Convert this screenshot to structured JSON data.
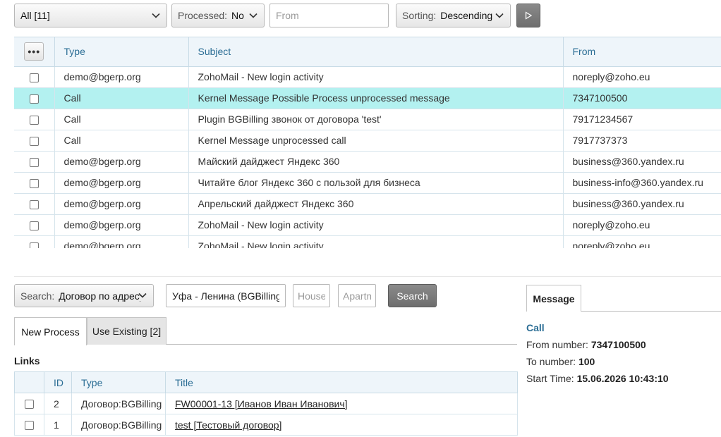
{
  "filters": {
    "type_select": {
      "value": "All [11]"
    },
    "processed_select": {
      "label": "Processed:",
      "value": "No"
    },
    "from_input": {
      "placeholder": "From",
      "value": ""
    },
    "sorting_select": {
      "label": "Sorting:",
      "value": "Descending"
    }
  },
  "message_table": {
    "more_label": "•••",
    "columns": [
      "Type",
      "Subject",
      "From"
    ],
    "rows": [
      {
        "type": "demo@bgerp.org",
        "subject": "ZohoMail - New login activity",
        "from": "noreply@zoho.eu",
        "selected": false
      },
      {
        "type": "Call",
        "subject": "Kernel Message Possible Process unprocessed message",
        "from": "7347100500",
        "selected": true
      },
      {
        "type": "Call",
        "subject": "Plugin BGBilling звонок от договора 'test'",
        "from": "79171234567",
        "selected": false
      },
      {
        "type": "Call",
        "subject": "Kernel Message unprocessed call",
        "from": "7917737373",
        "selected": false
      },
      {
        "type": "demo@bgerp.org",
        "subject": "Майский дайджест Яндекс 360",
        "from": "business@360.yandex.ru",
        "selected": false
      },
      {
        "type": "demo@bgerp.org",
        "subject": "Читайте блог Яндекс 360 с пользой для бизнеса",
        "from": "business-info@360.yandex.ru",
        "selected": false
      },
      {
        "type": "demo@bgerp.org",
        "subject": "Апрельский дайджест Яндекс 360",
        "from": "business@360.yandex.ru",
        "selected": false
      },
      {
        "type": "demo@bgerp.org",
        "subject": "ZohoMail - New login activity",
        "from": "noreply@zoho.eu",
        "selected": false
      },
      {
        "type": "demo@bgerp.org",
        "subject": "ZohoMail - New login activity",
        "from": "noreply@zoho.eu",
        "selected": false
      }
    ]
  },
  "search": {
    "mode_select": {
      "label": "Search:",
      "value": "Договор по адресу"
    },
    "address_input": {
      "value": "Уфа - Ленина (BGBilling Demo)",
      "placeholder": ""
    },
    "house_input": {
      "placeholder": "House/Frac",
      "value": ""
    },
    "apartment_input": {
      "placeholder": "Apartment",
      "value": ""
    },
    "search_button": "Search"
  },
  "process_tabs": {
    "new_process": "New Process",
    "use_existing": "Use Existing [2]"
  },
  "links": {
    "title": "Links",
    "columns": [
      "ID",
      "Type",
      "Title"
    ],
    "rows": [
      {
        "id": "2",
        "type": "Договор:BGBilling",
        "title": "FW00001-13 [Иванов Иван Иванович]"
      },
      {
        "id": "1",
        "type": "Договор:BGBilling",
        "title": "test [Тестовый договор]"
      }
    ]
  },
  "message_panel": {
    "tab": "Message",
    "type": "Call",
    "from_label": "From number:",
    "from_value": "7347100500",
    "to_label": "To number:",
    "to_value": "100",
    "start_label": "Start Time:",
    "start_value": "15.06.2026 10:43:10"
  },
  "colors": {
    "selected_row": "#b3f1f0",
    "header_bg": "#eef5fa",
    "header_text": "#2c6e95",
    "button_dark": "#7a7a7a"
  }
}
